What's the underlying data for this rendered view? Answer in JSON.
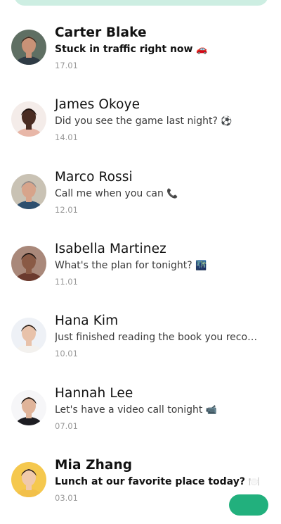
{
  "chats": [
    {
      "name": "Carter Blake",
      "message": "Stuck in traffic right now",
      "emoji": "🚗",
      "date": "17.01",
      "unread": true,
      "avatar": {
        "skin": "#c99277",
        "hair": "#3c2a20",
        "shirt": "#2f3b45",
        "bg": "#5f6f63"
      }
    },
    {
      "name": "James  Okoye",
      "message": "Did you see the game last night?",
      "emoji": "⚽",
      "date": "14.01",
      "unread": false,
      "avatar": {
        "skin": "#4a2c22",
        "hair": "#1c1210",
        "shirt": "#e8b7a8",
        "bg": "#f4ece9"
      }
    },
    {
      "name": "Marco  Rossi",
      "message": "Call me when you can",
      "emoji": "📞",
      "date": "12.01",
      "unread": false,
      "avatar": {
        "skin": "#d7a48b",
        "hair": "#8a8a8a",
        "shirt": "#2d4f6e",
        "bg": "#c9c2b4"
      }
    },
    {
      "name": "Isabella Martinez",
      "message": "What's the plan for tonight?",
      "emoji": "🌃",
      "date": "11.01",
      "unread": false,
      "avatar": {
        "skin": "#8a5a45",
        "hair": "#1a1412",
        "shirt": "#6b3a2e",
        "bg": "#a9887a"
      }
    },
    {
      "name": "Hana Kim",
      "message": "Just finished reading the book you recom...",
      "emoji": "",
      "date": "10.01",
      "unread": false,
      "avatar": {
        "skin": "#e8c2aa",
        "hair": "#2a211c",
        "shirt": "#f3f1ee",
        "bg": "#eef1f6"
      }
    },
    {
      "name": "Hannah Lee",
      "message": "Let's have a video call tonight",
      "emoji": "📹",
      "date": "07.01",
      "unread": false,
      "avatar": {
        "skin": "#e0b49a",
        "hair": "#17120f",
        "shirt": "#1d1d22",
        "bg": "#f6f6f8"
      }
    },
    {
      "name": "Mia Zhang",
      "message": "Lunch at our favorite place today?",
      "emoji": "🍽️",
      "date": "03.01",
      "unread": true,
      "avatar": {
        "skin": "#f0c9ab",
        "hair": "#2b1e17",
        "shirt": "#f2c04a",
        "bg": "#f5c84e"
      }
    }
  ],
  "colors": {
    "accent": "#22b07d",
    "search_bg": "#cdeee2"
  }
}
